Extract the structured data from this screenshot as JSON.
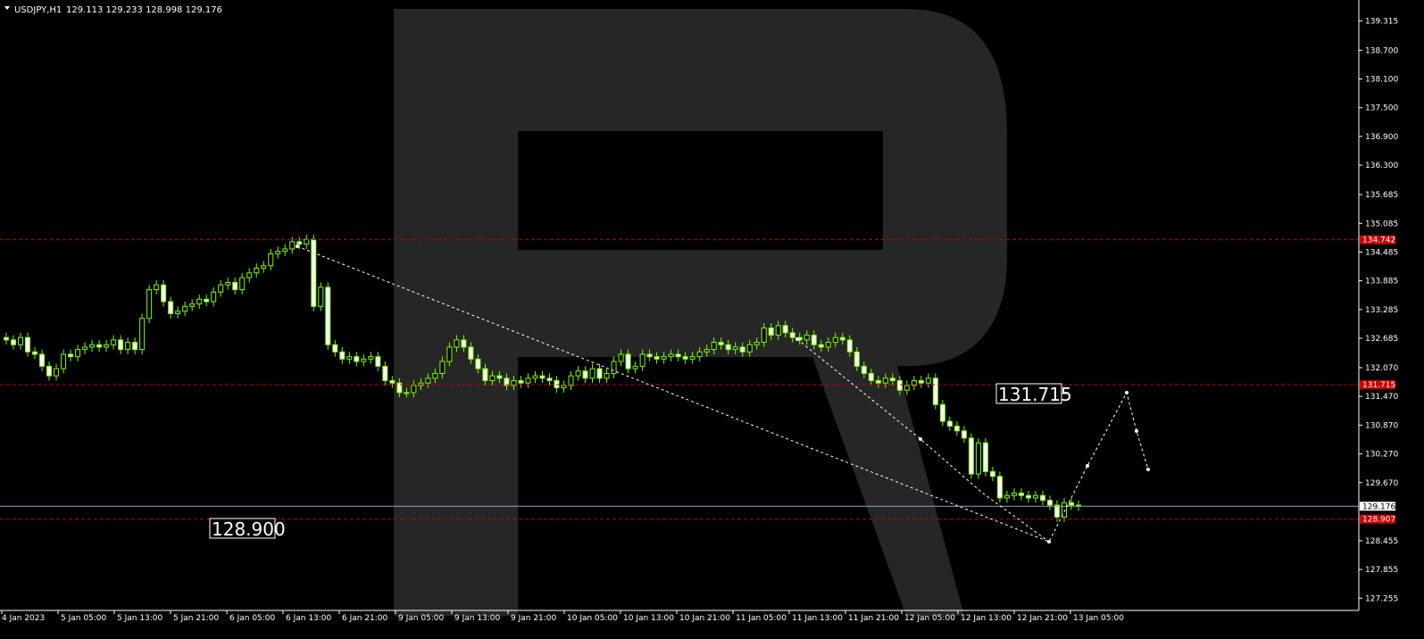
{
  "header": {
    "symbol": "USDJPY,H1",
    "ohlc": "129.113 129.233 128.998 129.176"
  },
  "colors": {
    "background": "#000000",
    "candle": "#7CFC00",
    "resistance": "#cc0000",
    "current": "#8fa5c8",
    "forecast": "#ffffff",
    "watermark": "#262626"
  },
  "callouts": {
    "upper": "131.715",
    "lower": "128.900"
  },
  "chart_data": {
    "type": "candlestick",
    "symbol": "USDJPY",
    "timeframe": "H1",
    "ylim": [
      127.0,
      139.75
    ],
    "y_ticks": [
      "139.315",
      "138.700",
      "138.100",
      "137.500",
      "136.900",
      "136.300",
      "135.685",
      "135.085",
      "134.485",
      "133.885",
      "133.285",
      "132.685",
      "132.070",
      "131.470",
      "130.870",
      "130.270",
      "129.670",
      "128.455",
      "127.855",
      "127.255"
    ],
    "x_ticks": [
      "4 Jan 2023",
      "5 Jan 05:00",
      "5 Jan 13:00",
      "5 Jan 21:00",
      "6 Jan 05:00",
      "6 Jan 13:00",
      "6 Jan 21:00",
      "9 Jan 05:00",
      "9 Jan 13:00",
      "9 Jan 21:00",
      "10 Jan 05:00",
      "10 Jan 13:00",
      "10 Jan 21:00",
      "11 Jan 05:00",
      "11 Jan 13:00",
      "11 Jan 21:00",
      "12 Jan 05:00",
      "12 Jan 13:00",
      "12 Jan 21:00",
      "13 Jan 05:00"
    ],
    "levels": [
      {
        "value": 134.742,
        "label": "134.742",
        "style": "dashed-red"
      },
      {
        "value": 131.715,
        "label": "131.715",
        "style": "dashed-red"
      },
      {
        "value": 129.176,
        "label": "129.176",
        "style": "solid-current"
      },
      {
        "value": 128.907,
        "label": "128.907",
        "style": "dashed-red"
      }
    ],
    "close": [
      132.65,
      132.55,
      132.7,
      132.4,
      132.35,
      132.1,
      131.9,
      132.05,
      132.35,
      132.3,
      132.45,
      132.5,
      132.55,
      132.5,
      132.55,
      132.65,
      132.45,
      132.6,
      132.45,
      133.1,
      133.7,
      133.8,
      133.45,
      133.2,
      133.25,
      133.35,
      133.4,
      133.5,
      133.45,
      133.65,
      133.8,
      133.85,
      133.7,
      133.95,
      134.05,
      134.15,
      134.2,
      134.45,
      134.5,
      134.55,
      134.7,
      134.65,
      134.75,
      133.35,
      133.75,
      132.55,
      132.4,
      132.25,
      132.3,
      132.2,
      132.25,
      132.3,
      132.1,
      131.8,
      131.75,
      131.55,
      131.55,
      131.7,
      131.75,
      131.85,
      131.95,
      132.2,
      132.5,
      132.65,
      132.5,
      132.25,
      132.05,
      131.8,
      131.9,
      131.85,
      131.7,
      131.8,
      131.75,
      131.85,
      131.9,
      131.85,
      131.8,
      131.65,
      131.7,
      131.9,
      132.0,
      131.85,
      132.05,
      131.85,
      131.95,
      132.2,
      132.35,
      132.05,
      132.1,
      132.35,
      132.3,
      132.25,
      132.3,
      132.35,
      132.3,
      132.25,
      132.3,
      132.4,
      132.45,
      132.6,
      132.55,
      132.45,
      132.5,
      132.4,
      132.55,
      132.6,
      132.9,
      132.75,
      132.95,
      132.8,
      132.7,
      132.65,
      132.75,
      132.55,
      132.5,
      132.6,
      132.7,
      132.65,
      132.4,
      132.1,
      131.95,
      131.8,
      131.75,
      131.85,
      131.8,
      131.6,
      131.7,
      131.8,
      131.75,
      131.85,
      131.3,
      130.95,
      130.85,
      130.75,
      130.6,
      129.85,
      130.5,
      129.9,
      129.8,
      129.35,
      129.4,
      129.45,
      129.4,
      129.35,
      129.4,
      129.3,
      129.2,
      128.95,
      129.25,
      129.2,
      129.18
    ]
  }
}
